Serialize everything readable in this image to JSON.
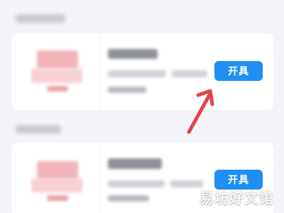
{
  "cards": [
    {
      "issue_button_label": "开具"
    },
    {
      "issue_button_label": "开具"
    }
  ],
  "watermark": {
    "text": "易坊好文馆"
  },
  "colors": {
    "page_background": "#f4f5f8",
    "card_background": "#ffffff",
    "button_blue": "#1f8ff2",
    "arrow_red": "#e8424a"
  }
}
